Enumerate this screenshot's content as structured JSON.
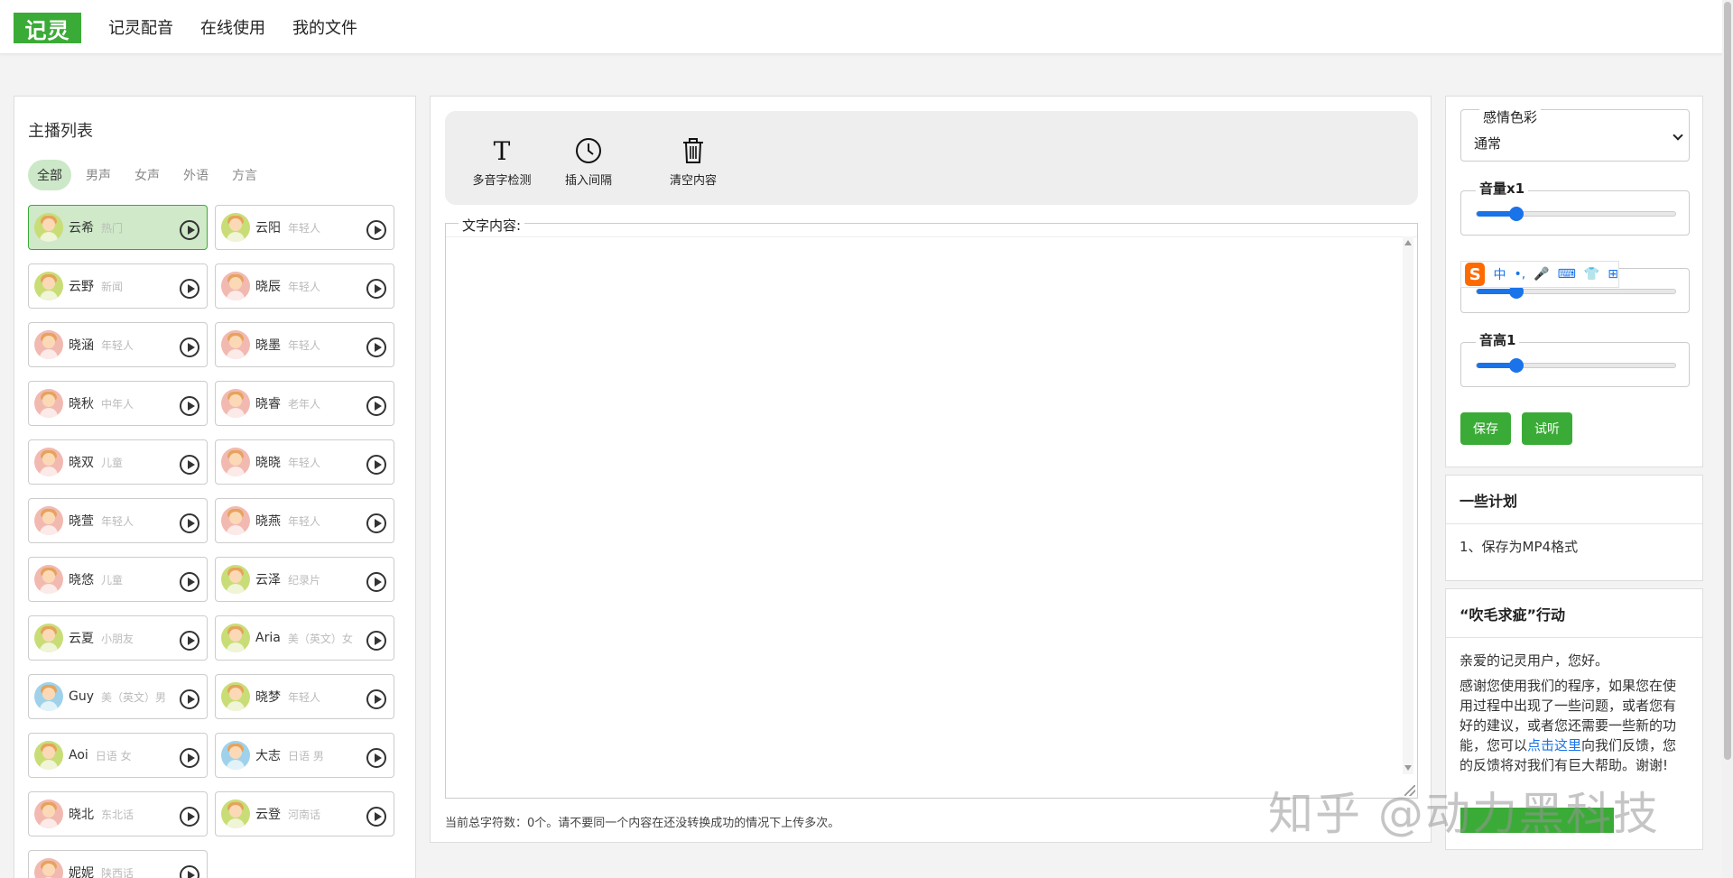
{
  "nav": {
    "logo": "记灵",
    "links": [
      "记灵配音",
      "在线使用",
      "我的文件"
    ]
  },
  "left": {
    "title": "主播列表",
    "filters": [
      "全部",
      "男声",
      "女声",
      "外语",
      "方言"
    ],
    "active_filter": "全部",
    "anchors": [
      {
        "name": "云希",
        "tag": "热门",
        "avatar": "y",
        "selected": true
      },
      {
        "name": "云阳",
        "tag": "年轻人",
        "avatar": "y"
      },
      {
        "name": "云野",
        "tag": "新闻",
        "avatar": "y"
      },
      {
        "name": "晓辰",
        "tag": "年轻人",
        "avatar": "f"
      },
      {
        "name": "晓涵",
        "tag": "年轻人",
        "avatar": "f"
      },
      {
        "name": "晓墨",
        "tag": "年轻人",
        "avatar": "f"
      },
      {
        "name": "晓秋",
        "tag": "中年人",
        "avatar": "f"
      },
      {
        "name": "晓睿",
        "tag": "老年人",
        "avatar": "f"
      },
      {
        "name": "晓双",
        "tag": "儿童",
        "avatar": "f"
      },
      {
        "name": "晓晓",
        "tag": "年轻人",
        "avatar": "f"
      },
      {
        "name": "晓萱",
        "tag": "年轻人",
        "avatar": "f"
      },
      {
        "name": "晓燕",
        "tag": "年轻人",
        "avatar": "f"
      },
      {
        "name": "晓悠",
        "tag": "儿童",
        "avatar": "f"
      },
      {
        "name": "云泽",
        "tag": "纪录片",
        "avatar": "y"
      },
      {
        "name": "云夏",
        "tag": "小朋友",
        "avatar": "y"
      },
      {
        "name": "Aria",
        "tag": "美（英文）女",
        "avatar": "y"
      },
      {
        "name": "Guy",
        "tag": "美（英文）男",
        "avatar": "m"
      },
      {
        "name": "晓梦",
        "tag": "年轻人",
        "avatar": "y"
      },
      {
        "name": "Aoi",
        "tag": "日语 女",
        "avatar": "y"
      },
      {
        "name": "大志",
        "tag": "日语 男",
        "avatar": "m"
      },
      {
        "name": "晓北",
        "tag": "东北话",
        "avatar": "f"
      },
      {
        "name": "云登",
        "tag": "河南话",
        "avatar": "y"
      },
      {
        "name": "妮妮",
        "tag": "陕西话",
        "avatar": "f"
      }
    ]
  },
  "toolbar": {
    "polyphone": "多音字检测",
    "insert_pause": "插入间隔",
    "clear": "清空内容"
  },
  "editor": {
    "legend": "文字内容:",
    "value": "",
    "stat": "当前总字符数：0个。请不要同一个内容在还没转换成功的情况下上传多次。"
  },
  "controls": {
    "emotion_label": "感情色彩",
    "emotion_value": "通常",
    "volume_label": "音量x1",
    "volume_level": 0.2,
    "speed_level": 0.2,
    "pitch_label": "音高1",
    "pitch_level": 0.2,
    "save": "保存",
    "preview": "试听"
  },
  "ime": {
    "logo": "S",
    "lang": "中",
    "punct": "•,",
    "mic": "🎤",
    "keyboard": "⌨",
    "skin": "👕",
    "grid": "⊞"
  },
  "plans": {
    "title": "一些计划",
    "items": [
      "1、保存为MP4格式"
    ]
  },
  "feedback": {
    "title": "“吹毛求疵”行动",
    "greeting": "亲爱的记灵用户，您好。",
    "text_before": "感谢您使用我们的程序，如果您在使用过程中出现了一些问题，或者您有好的建议，或者您还需要一些新的功能，您可以",
    "link": "点击这里",
    "text_after": "向我们反馈，您的反馈将对我们有巨大帮助。谢谢!"
  },
  "watermark": "知乎 @动力黑科技"
}
